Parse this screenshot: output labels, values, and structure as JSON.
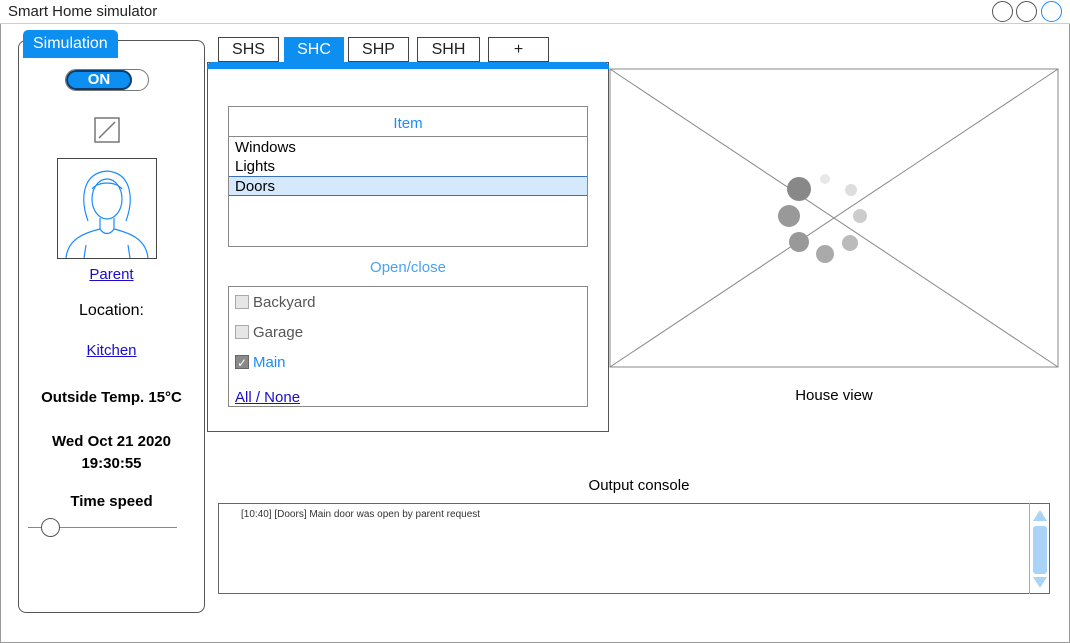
{
  "window": {
    "title": "Smart Home simulator"
  },
  "simulation": {
    "tab_label": "Simulation",
    "toggle_label": "ON",
    "user_role": "Parent",
    "location_label": "Location:",
    "location_value": "Kitchen",
    "outside_temp": "Outside Temp. 15°C",
    "date": "Wed Oct 21 2020",
    "time": "19:30:55",
    "time_speed_label": "Time speed",
    "time_speed_level": 0.15
  },
  "tabs": [
    "SHS",
    "SHC",
    "SHP",
    "SHH",
    "+"
  ],
  "active_tab": "SHC",
  "shc": {
    "item_header": "Item",
    "items": [
      "Windows",
      "Lights",
      "Doors"
    ],
    "selected_item": "Doors",
    "open_close_label": "Open/close",
    "options": [
      {
        "label": "Backyard",
        "checked": false
      },
      {
        "label": "Garage",
        "checked": false
      },
      {
        "label": "Main",
        "checked": true
      }
    ],
    "all_none": "All / None"
  },
  "house_view": {
    "label": "House view"
  },
  "console": {
    "label": "Output console",
    "lines": [
      "[10:40] [Doors] Main door was open by parent request"
    ]
  },
  "colors": {
    "accent": "#0c8ff1",
    "link": "#1a0dcc",
    "selection": "#d6e8fb"
  }
}
